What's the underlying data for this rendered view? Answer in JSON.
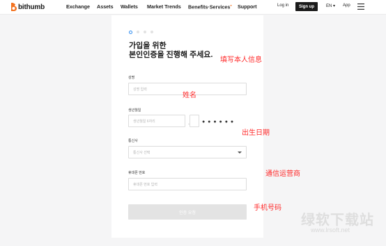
{
  "header": {
    "logo_text": "bithumb",
    "nav": [
      "Exchange",
      "Assets",
      "Wallets",
      "Market Trends",
      "Benefits·Services",
      "Support"
    ],
    "login_label": "Log in",
    "signup_label": "Sign up",
    "language": "EN ▾",
    "app_label": "App"
  },
  "form": {
    "title_line1": "가입을 위한",
    "title_line2": "본인인증을 진행해 주세요.",
    "name_label": "성명",
    "name_placeholder": "성명 입력",
    "birth_label": "생년월일",
    "birth_placeholder": "생년월일 6자리",
    "birth_dash": "-",
    "masked_digits": "● ● ● ● ● ●",
    "carrier_label": "통신사",
    "carrier_placeholder": "통신사 선택",
    "phone_label": "휴대폰 번호",
    "phone_placeholder": "휴대폰 번호 입력",
    "submit_label": "인증 요청"
  },
  "annotations": {
    "personal_info": "填写本人信息",
    "name": "姓名",
    "birth": "出生日期",
    "carrier": "通信运营商",
    "phone": "手机号码"
  },
  "watermark": {
    "text": "绿软下载站",
    "url": "www.lrsoft.net"
  },
  "colors": {
    "brand_orange": "#f37321",
    "annotation_red": "#ff2a2a",
    "signup_bg": "#1a1a1a",
    "step_active": "#2d8cf0"
  }
}
